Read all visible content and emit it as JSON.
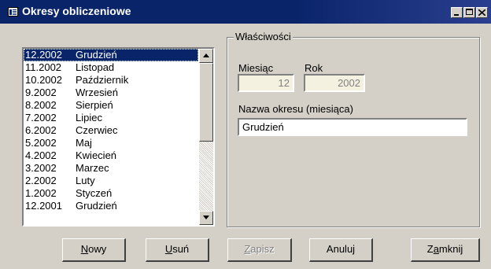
{
  "window": {
    "title": "Okresy obliczeniowe"
  },
  "list": {
    "items": [
      {
        "period": "12.2002",
        "month": "Grudzień",
        "selected": true
      },
      {
        "period": "11.2002",
        "month": "Listopad"
      },
      {
        "period": "10.2002",
        "month": "Październik"
      },
      {
        "period": "9.2002",
        "month": "Wrzesień"
      },
      {
        "period": "8.2002",
        "month": "Sierpień"
      },
      {
        "period": "7.2002",
        "month": "Lipiec"
      },
      {
        "period": "6.2002",
        "month": "Czerwiec"
      },
      {
        "period": "5.2002",
        "month": "Maj"
      },
      {
        "period": "4.2002",
        "month": "Kwiecień"
      },
      {
        "period": "3.2002",
        "month": "Marzec"
      },
      {
        "period": "2.2002",
        "month": "Luty"
      },
      {
        "period": "1.2002",
        "month": "Styczeń"
      },
      {
        "period": "12.2001",
        "month": "Grudzień"
      }
    ]
  },
  "properties": {
    "title": "Właściwości",
    "month_label": "Miesiąc",
    "month_value": "12",
    "year_label": "Rok",
    "year_value": "2002",
    "name_label": "Nazwa okresu (miesiąca)",
    "name_value": "Grudzień"
  },
  "buttons": {
    "new": {
      "hotkey": "N",
      "rest": "owy"
    },
    "delete": {
      "hotkey": "U",
      "rest": "suń"
    },
    "save": {
      "hotkey": "Z",
      "rest": "apisz",
      "disabled": true
    },
    "cancel": {
      "label": "Anuluj"
    },
    "close": {
      "pre": "Z",
      "hotkey": "a",
      "rest": "mknij"
    }
  },
  "colors": {
    "titlebar": "#0a246a",
    "face": "#d4d0c8",
    "selection": "#0a246a",
    "readonly_field": "#f4f1e1"
  }
}
